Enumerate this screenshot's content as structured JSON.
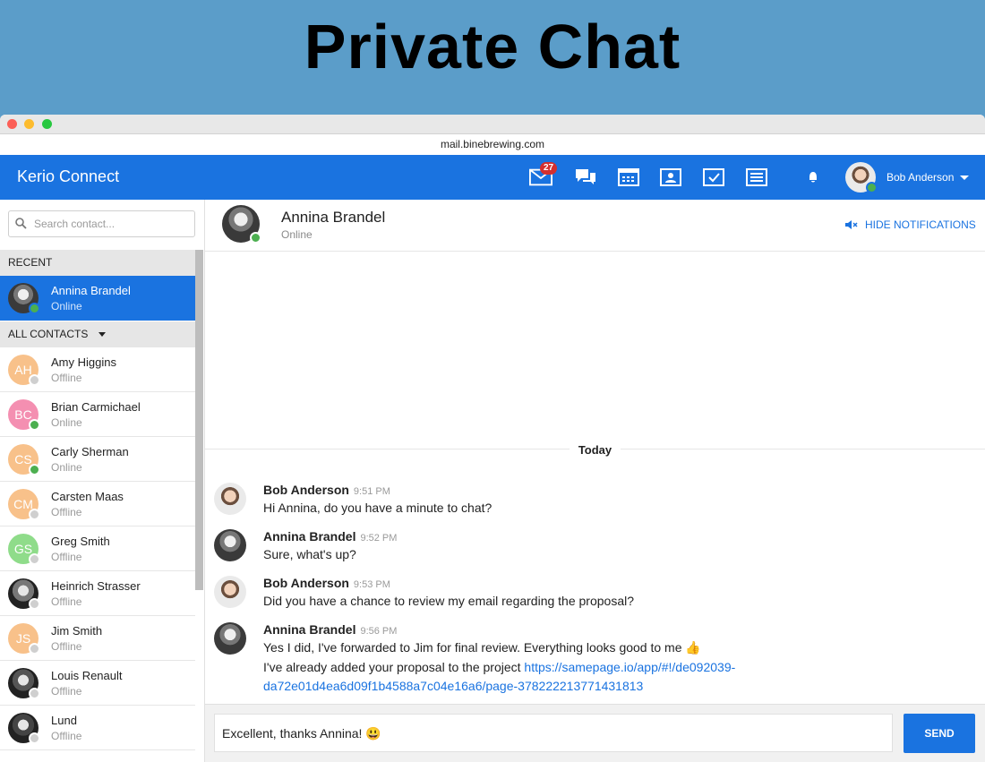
{
  "banner": {
    "title": "Private Chat"
  },
  "browser": {
    "url": "mail.binebrewing.com"
  },
  "app": {
    "brand": "Kerio Connect",
    "mail_badge": "27",
    "user_name": "Bob Anderson"
  },
  "sidebar": {
    "search_placeholder": "Search contact...",
    "recent_label": "RECENT",
    "all_contacts_label": "ALL CONTACTS",
    "recent": [
      {
        "name": "Annina Brandel",
        "status": "Online",
        "online": true
      }
    ],
    "contacts": [
      {
        "initials": "AH",
        "name": "Amy Higgins",
        "status": "Offline",
        "color": "#f8c18a",
        "online": false
      },
      {
        "initials": "BC",
        "name": "Brian Carmichael",
        "status": "Online",
        "color": "#f48fb1",
        "online": true
      },
      {
        "initials": "CS",
        "name": "Carly Sherman",
        "status": "Online",
        "color": "#f8c18a",
        "online": true
      },
      {
        "initials": "CM",
        "name": "Carsten Maas",
        "status": "Offline",
        "color": "#f8c18a",
        "online": false
      },
      {
        "initials": "GS",
        "name": "Greg Smith",
        "status": "Offline",
        "color": "#8fdc8a",
        "online": false
      },
      {
        "initials": "",
        "name": "Heinrich Strasser",
        "status": "Offline",
        "color": "#777777",
        "online": false
      },
      {
        "initials": "JS",
        "name": "Jim Smith",
        "status": "Offline",
        "color": "#f8c18a",
        "online": false
      },
      {
        "initials": "",
        "name": "Louis Renault",
        "status": "Offline",
        "color": "#555555",
        "online": false
      },
      {
        "initials": "",
        "name": "Lund",
        "status": "Offline",
        "color": "#444444",
        "online": false
      }
    ]
  },
  "chat": {
    "contact_name": "Annina Brandel",
    "contact_status": "Online",
    "hide_notifications": "HIDE NOTIFICATIONS",
    "day_label": "Today",
    "messages": [
      {
        "author": "Bob Anderson",
        "time": "9:51 PM",
        "lines": [
          "Hi Annina, do you have a minute to chat?"
        ]
      },
      {
        "author": "Annina Brandel",
        "time": "9:52 PM",
        "lines": [
          "Sure, what's up?"
        ]
      },
      {
        "author": "Bob Anderson",
        "time": "9:53 PM",
        "lines": [
          "Did you have a chance to review my email regarding the proposal?"
        ]
      },
      {
        "author": "Annina Brandel",
        "time": "9:56 PM",
        "lines": [
          "Yes I did, I've forwarded to Jim for final review. Everything looks good to me 👍"
        ],
        "link_prefix": "I've already added your proposal to the project ",
        "link_part1": "https://samepage.io/app/#!/de092039-",
        "link_part2": "da72e01d4ea6d09f1b4588a7c04e16a6/page-378222213771431813"
      }
    ],
    "compose_value": "Excellent, thanks Annina! 😃",
    "send_label": "SEND"
  },
  "colors": {
    "accent": "#1a73e0",
    "online": "#4caf50",
    "offline": "#cfcfcf",
    "badge": "#d32f2f"
  }
}
